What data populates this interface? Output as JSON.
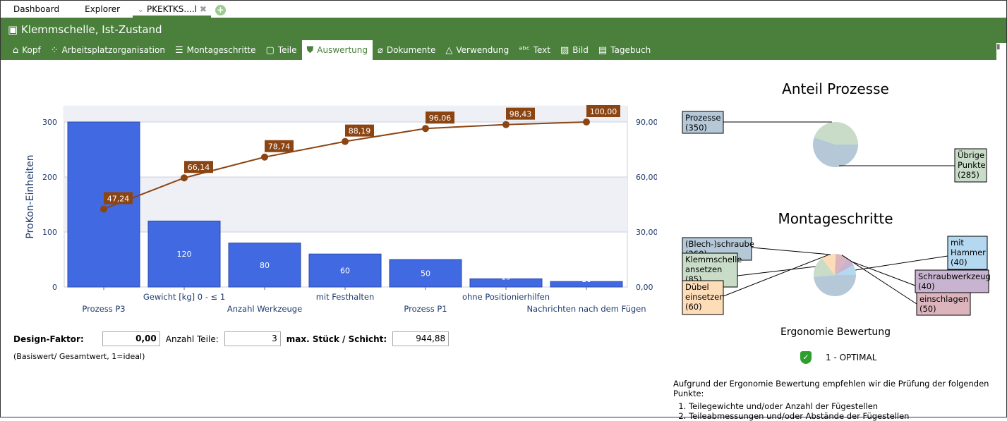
{
  "tabs": [
    "Dashboard",
    "Explorer",
    "PKEKTKS....l"
  ],
  "header": {
    "title": "Klemmschelle, Ist-Zustand",
    "nav": [
      {
        "label": "Kopf",
        "icon": "home-icon"
      },
      {
        "label": "Arbeitsplatzorganisation",
        "icon": "org-icon"
      },
      {
        "label": "Montageschritte",
        "icon": "list-icon"
      },
      {
        "label": "Teile",
        "icon": "box-icon"
      },
      {
        "label": "Auswertung",
        "icon": "shield-icon",
        "active": true
      },
      {
        "label": "Dokumente",
        "icon": "paperclip-icon"
      },
      {
        "label": "Verwendung",
        "icon": "recycle-icon"
      },
      {
        "label": "Text",
        "icon": "abc-icon"
      },
      {
        "label": "Bild",
        "icon": "image-icon"
      },
      {
        "label": "Tagebuch",
        "icon": "notebook-icon"
      }
    ]
  },
  "chart_data": [
    {
      "type": "bar",
      "ylabel": "ProKon-Einheiten",
      "ylim": [
        0,
        330
      ],
      "yticks": [
        "0",
        "100",
        "200",
        "300"
      ],
      "y2ticks": [
        "0,00",
        "30,00",
        "60,00",
        "90,00"
      ],
      "grid": true,
      "categories": [
        "Prozess P3",
        "Gewicht [kg] 0 - ≤ 1",
        "Anzahl Werkzeuge",
        "mit Festhalten",
        "Prozess P1",
        "ohne Positionierhilfen",
        "Nachrichten nach dem Fügen"
      ],
      "values": [
        300,
        120,
        80,
        60,
        50,
        15,
        10
      ],
      "value_labels": [
        "",
        "120",
        "80",
        "60",
        "50",
        "15",
        "10"
      ],
      "cumulative_pct": [
        47.24,
        66.14,
        78.74,
        88.19,
        96.06,
        98.43,
        100.0
      ],
      "cumulative_labels": [
        "47,24",
        "66,14",
        "78,74",
        "88,19",
        "96,06",
        "98,43",
        "100,00"
      ],
      "bar_color": "#4169e1",
      "line_color": "#8b4513"
    },
    {
      "type": "pie",
      "title": "Anteil Prozesse",
      "labels": [
        "Prozesse",
        "Übrige Punkte"
      ],
      "values": [
        350,
        285
      ],
      "colors": [
        "#b4c8d8",
        "#c8dcc8"
      ]
    },
    {
      "type": "pie",
      "title": "Montageschritte",
      "labels": [
        "(Blech-)schraube",
        "Klemmschelle ansetzen",
        "Dübel einsetzen",
        "einschlagen",
        "Schraubwerkzeug",
        "mit Hammer"
      ],
      "values": [
        260,
        85,
        60,
        50,
        40,
        40
      ],
      "colors": [
        "#b4c8d8",
        "#c8dcc8",
        "#fddcb8",
        "#dcb4bc",
        "#c8b4d0",
        "#b4d8f0"
      ]
    }
  ],
  "form": {
    "design_label": "Design-Faktor:",
    "design_value": "0,00",
    "teile_label": "Anzahl Teile:",
    "teile_value": "3",
    "max_label": "max. Stück / Schicht:",
    "max_value": "944,88",
    "note": "(Basiswert/ Gesamtwert, 1=ideal)"
  },
  "ergonomie": {
    "title": "Ergonomie Bewertung",
    "rating": "1 - OPTIMAL",
    "intro": "Aufgrund der Ergonomie Bewertung empfehlen wir die Prüfung der folgenden Punkte:",
    "items": [
      "Teilegewichte und/oder Anzahl der Fügestellen",
      "Teileabmessungen und/oder Abstände der Fügestellen"
    ]
  }
}
